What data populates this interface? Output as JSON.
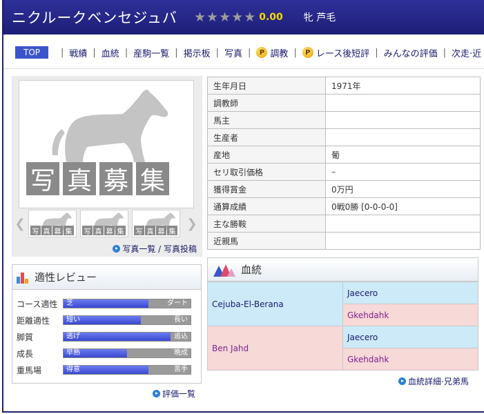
{
  "header": {
    "horse_name": "ニクルークベンセジュバ",
    "stars": [
      "★",
      "★",
      "★",
      "★",
      "★"
    ],
    "rating": "0.00",
    "sex_color": "牝  芦毛"
  },
  "nav": {
    "top": "TOP",
    "items": [
      "戦績",
      "血統",
      "産駒一覧",
      "掲示板",
      "写真",
      "調教",
      "レース後短評",
      "みんなの評価",
      "次走·近"
    ]
  },
  "photo": {
    "boshu": [
      "写",
      "真",
      "募",
      "集"
    ],
    "links": "写真一覧 / 写真投稿"
  },
  "review": {
    "title": "適性レビュー",
    "rows": [
      {
        "label": "コース適性",
        "left": "芝",
        "right": "ダート",
        "fill": 0.67
      },
      {
        "label": "距離適性",
        "left": "短い",
        "right": "長い",
        "fill": 0.61
      },
      {
        "label": "脚質",
        "left": "逃げ",
        "right": "追込",
        "fill": 0.84
      },
      {
        "label": "成長",
        "left": "早熟",
        "right": "晩成",
        "fill": 0.5
      },
      {
        "label": "重馬場",
        "left": "得意",
        "right": "苦手",
        "fill": 0.67
      }
    ],
    "eval_link": "評価一覧"
  },
  "profile": [
    {
      "k": "生年月日",
      "v": "1971年"
    },
    {
      "k": "調教師",
      "v": ""
    },
    {
      "k": "馬主",
      "v": ""
    },
    {
      "k": "生産者",
      "v": ""
    },
    {
      "k": "産地",
      "v": "葡"
    },
    {
      "k": "セリ取引価格",
      "v": "–"
    },
    {
      "k": "獲得賞金",
      "v": "0万円"
    },
    {
      "k": "通算成績",
      "v": "0戦0勝 [0-0-0-0]"
    },
    {
      "k": "主な勝鞍",
      "v": ""
    },
    {
      "k": "近親馬",
      "v": ""
    }
  ],
  "pedigree": {
    "title": "血統",
    "sire": "Cejuba-El-Berana",
    "sire_sire": "Jaecero",
    "sire_dam": "Gkehdahk",
    "dam": "Ben Jahd",
    "dam_sire": "Jaecero",
    "dam_dam": "Gkehdahk",
    "link": "血統詳細·兄弟馬"
  },
  "colors": {
    "header": "#1d1e76",
    "nav_top": "#3a54cc",
    "rating": "#f5d800",
    "ped_blue": "#cceaf8",
    "ped_pink": "#f7d9d8"
  }
}
